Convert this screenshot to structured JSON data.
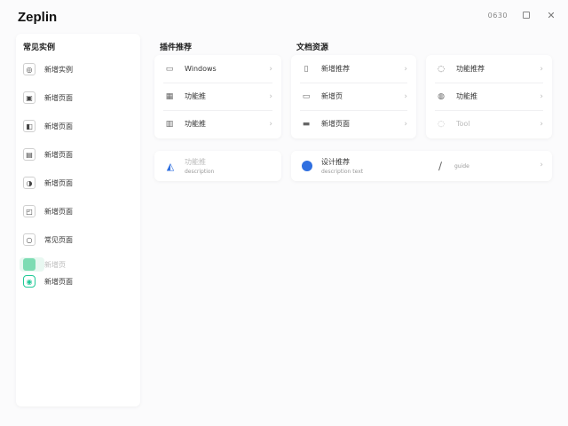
{
  "app": {
    "title": "Zeplin"
  },
  "window": {
    "status_text": "0630",
    "maximize": "□",
    "close": "✕"
  },
  "sidebar": {
    "title": "常见实例",
    "items": [
      {
        "label": "新增实例",
        "icon": "◎"
      },
      {
        "label": "新增页面",
        "icon": "▣"
      },
      {
        "label": "新增页面",
        "icon": "◧"
      },
      {
        "label": "新增页面",
        "icon": "▤"
      },
      {
        "label": "新增页面",
        "icon": "◑"
      },
      {
        "label": "新增页面",
        "icon": "◰"
      },
      {
        "label": "常见页面",
        "icon": "○"
      },
      {
        "label": "新增页",
        "icon": "■"
      },
      {
        "label": "新增页面",
        "icon": "◉"
      }
    ]
  },
  "sections": {
    "a_title": "插件推荐",
    "b_title": "文档资源"
  },
  "card_a": {
    "rows": [
      {
        "label": "Windows",
        "icon": "▭"
      },
      {
        "label": "功能推",
        "icon": "▦"
      },
      {
        "label": "功能推",
        "icon": "▥"
      }
    ]
  },
  "card_b": {
    "rows": [
      {
        "label": "新增推荐",
        "icon": "▯"
      },
      {
        "label": "新增页",
        "icon": "▭"
      },
      {
        "label": "新增页面",
        "icon": "▬"
      }
    ]
  },
  "card_c": {
    "rows": [
      {
        "label": "功能推荐",
        "icon": "◌"
      },
      {
        "label": "功能推",
        "icon": "◍"
      },
      {
        "label": "Tool",
        "icon": "◌"
      }
    ]
  },
  "bottom": {
    "left": {
      "line1": "功能推",
      "line2": "description",
      "icon": "◭"
    },
    "right": {
      "line1": "设计推荐",
      "line2": "description text",
      "icon2_label": "guide",
      "icon2": "∕"
    }
  },
  "chevron": "›"
}
